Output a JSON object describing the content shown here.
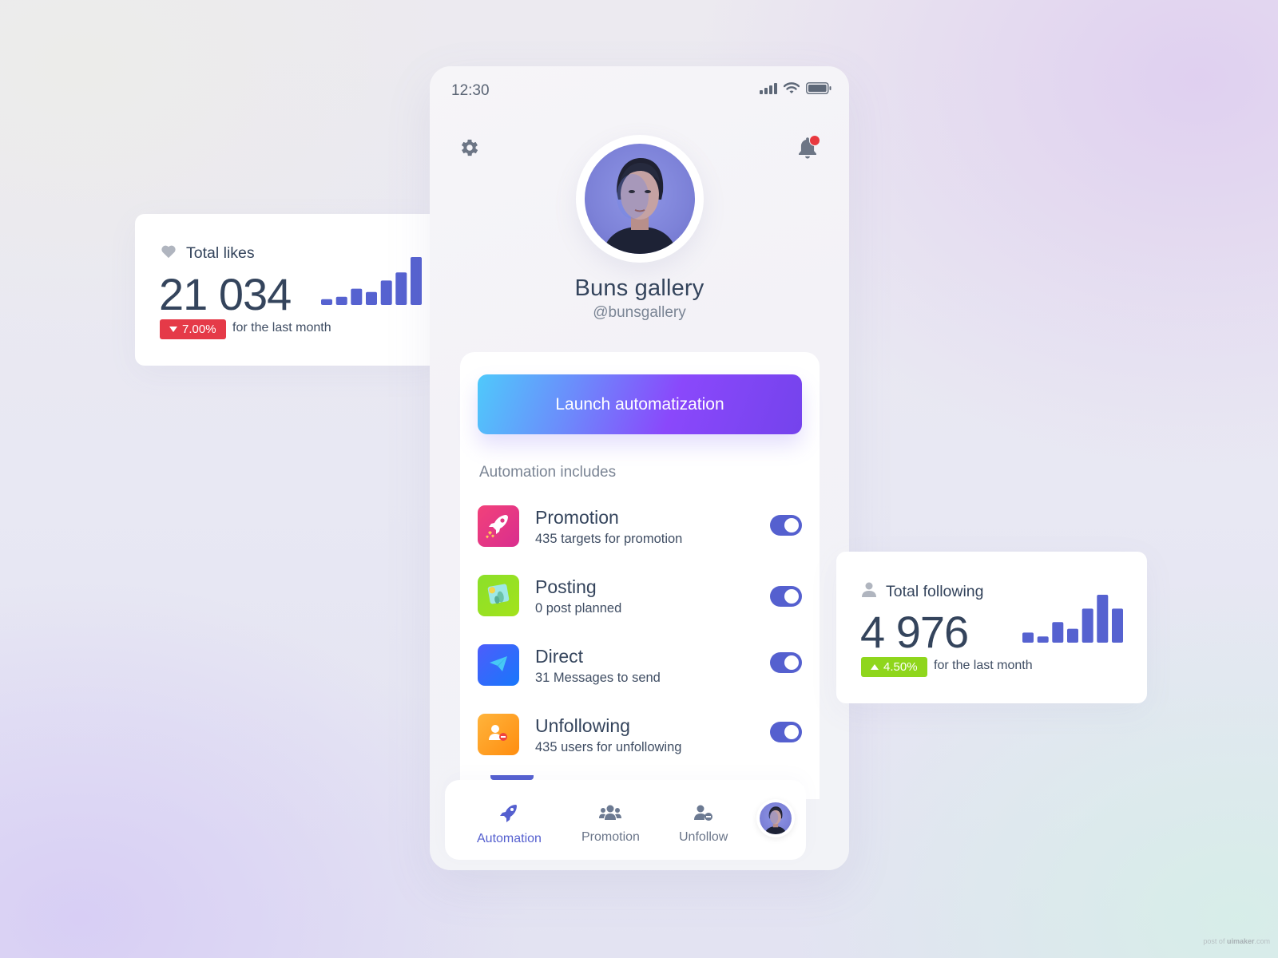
{
  "status_bar": {
    "time": "12:30",
    "icons": [
      "signal-icon",
      "wifi-icon",
      "battery-icon"
    ]
  },
  "header": {
    "settings_icon": "gear-icon",
    "notifications_icon": "bell-icon",
    "has_unread_notification": true
  },
  "profile": {
    "name": "Buns gallery",
    "handle": "@bunsgallery"
  },
  "launch_button": {
    "label": "Launch automatization"
  },
  "automation": {
    "section_label": "Automation includes",
    "items": [
      {
        "title": "Promotion",
        "subtitle": "435 targets for promotion",
        "icon": "rocket-icon",
        "enabled": true,
        "color_from": "#f2417a",
        "color_to": "#d92e8e"
      },
      {
        "title": "Posting",
        "subtitle": "0 post planned",
        "icon": "image-icon",
        "enabled": true,
        "color_from": "#8be02a",
        "color_to": "#a3e21b"
      },
      {
        "title": "Direct",
        "subtitle": "31 Messages to send",
        "icon": "paper-plane-icon",
        "enabled": true,
        "color_from": "#4d5dfb",
        "color_to": "#1877fb"
      },
      {
        "title": "Unfollowing",
        "subtitle": "435 users for unfollowing",
        "icon": "user-minus-icon",
        "enabled": true,
        "color_from": "#ffb43c",
        "color_to": "#ff8d0f"
      }
    ]
  },
  "bottom_nav": {
    "items": [
      {
        "label": "Automation",
        "icon": "rocket-icon",
        "active": true
      },
      {
        "label": "Promotion",
        "icon": "users-icon",
        "active": false
      },
      {
        "label": "Unfollow",
        "icon": "user-minus-icon",
        "active": false
      }
    ],
    "profile_icon": "avatar"
  },
  "stats": {
    "likes": {
      "title": "Total likes",
      "icon": "heart-icon",
      "value": "21 034",
      "change": "7.00%",
      "direction": "down",
      "note": "for the last month",
      "badge_color": "#e53a48"
    },
    "following": {
      "title": "Total following",
      "icon": "user-icon",
      "value": "4 976",
      "change": "4.50%",
      "direction": "up",
      "note": "for the last month",
      "badge_color": "#8fd61c"
    }
  },
  "chart_data": [
    {
      "type": "bar",
      "title": "Total likes",
      "categories": [
        "1",
        "2",
        "3",
        "4",
        "5",
        "6",
        "7"
      ],
      "values": [
        12,
        17,
        34,
        27,
        51,
        68,
        100
      ],
      "ylim": [
        0,
        100
      ],
      "color": "#5662d0"
    },
    {
      "type": "bar",
      "title": "Total following",
      "categories": [
        "1",
        "2",
        "3",
        "4",
        "5",
        "6",
        "7"
      ],
      "values": [
        21,
        13,
        43,
        29,
        71,
        100,
        71
      ],
      "ylim": [
        0,
        100
      ],
      "color": "#5662d0"
    }
  ],
  "accent_color": "#5560cf",
  "watermark": {
    "prefix": "post of ",
    "brand": "uimaker",
    "suffix": ".com"
  }
}
